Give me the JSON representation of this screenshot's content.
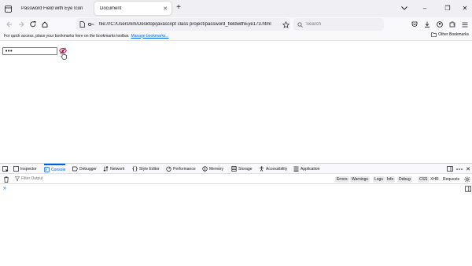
{
  "tabs": [
    {
      "title": "Password Field with Eye Icon",
      "active": false
    },
    {
      "title": "Document",
      "active": true
    }
  ],
  "window_controls": {
    "minimize": "–",
    "restore": "❐",
    "close": "✕"
  },
  "navbar": {
    "url": "file:///C:/Users/km/Desktop/javascript class project/password_fieldwithEye173.html",
    "search_placeholder": "Search"
  },
  "bookmarks": {
    "message": "For quick access, place your bookmarks here on the bookmarks toolbar.",
    "manage_link": "Manage bookmarks...",
    "other": "Other Bookmarks"
  },
  "page": {
    "password_value": "•••",
    "accent_color": "#c50042"
  },
  "devtools": {
    "tabs": [
      {
        "label": "Inspector",
        "icon": "inspector-icon"
      },
      {
        "label": "Console",
        "icon": "console-icon",
        "active": true
      },
      {
        "label": "Debugger",
        "icon": "debugger-icon"
      },
      {
        "label": "Network",
        "icon": "network-icon"
      },
      {
        "label": "Style Editor",
        "icon": "style-editor-icon"
      },
      {
        "label": "Performance",
        "icon": "performance-icon"
      },
      {
        "label": "Memory",
        "icon": "memory-icon"
      },
      {
        "label": "Storage",
        "icon": "storage-icon"
      },
      {
        "label": "Accessibility",
        "icon": "accessibility-icon"
      },
      {
        "label": "Application",
        "icon": "application-icon"
      }
    ],
    "filter_placeholder": "Filter Output",
    "levels": [
      "Errors",
      "Warnings",
      "Logs",
      "Info",
      "Debug"
    ],
    "extra_filters": [
      "CSS",
      "XHR",
      "Requests"
    ],
    "prompt": "»"
  }
}
